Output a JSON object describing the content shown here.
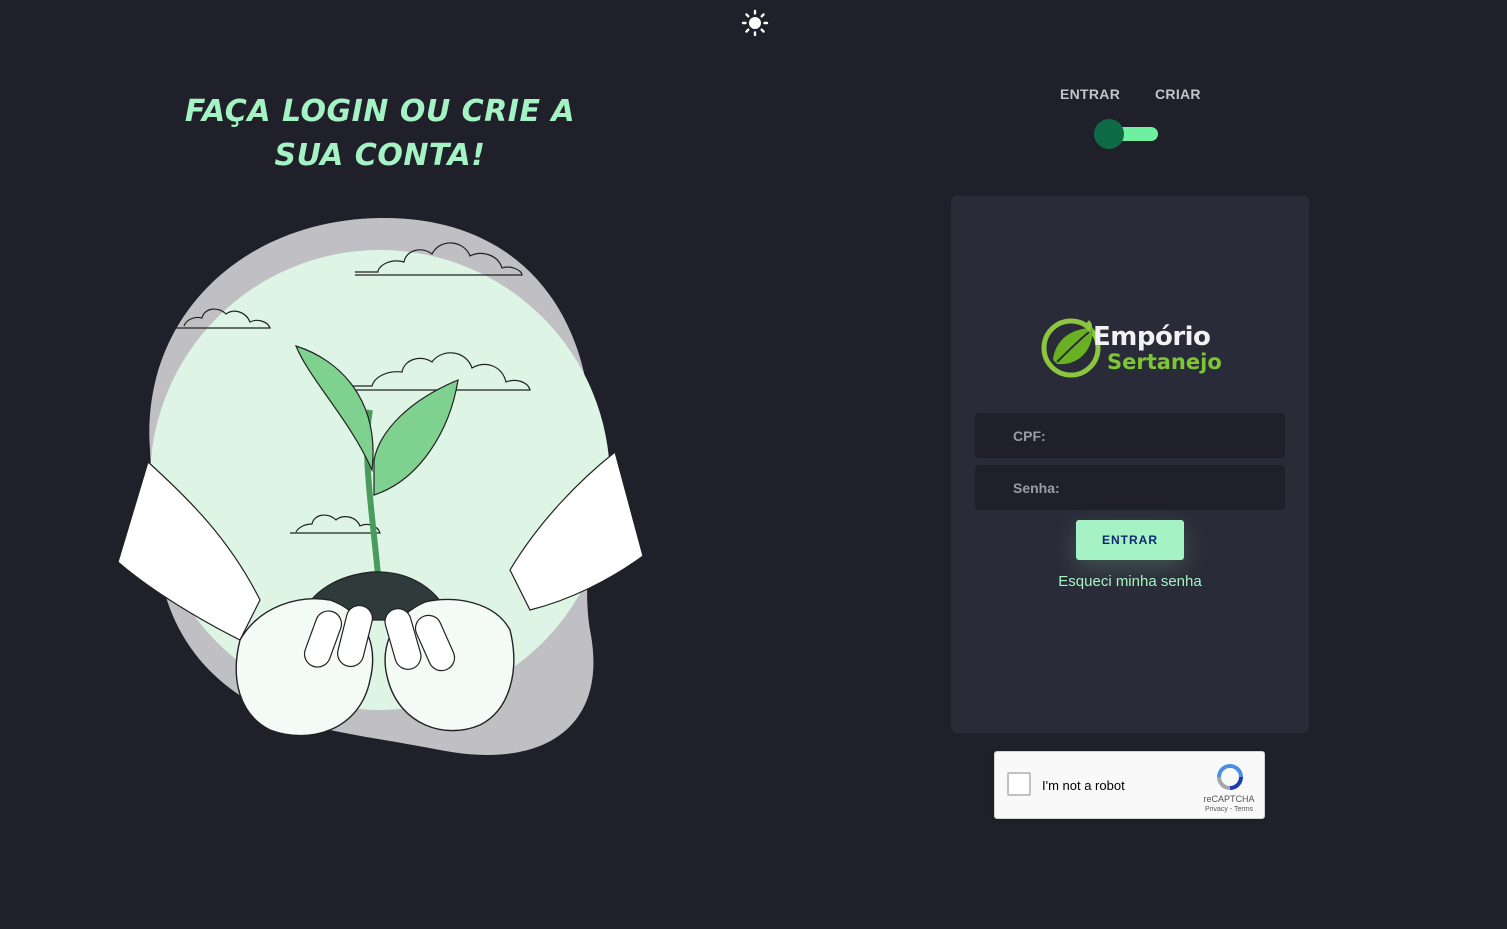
{
  "headline": {
    "line1": "FAÇA LOGIN OU CRIE A",
    "line2": "SUA CONTA!"
  },
  "icons": {
    "theme": "sun-icon",
    "illustration": "plant-in-hands-illustration",
    "logo": "leaf-logo-icon"
  },
  "tabs": {
    "entrar": "ENTRAR",
    "criar": "CRIAR",
    "active": "entrar"
  },
  "brand": {
    "name_top": "Empório",
    "name_bottom": "Sertanejo"
  },
  "form": {
    "cpf_placeholder": "CPF:",
    "senha_placeholder": "Senha:",
    "submit_label": "ENTRAR",
    "forgot_label": "Esqueci minha senha"
  },
  "recaptcha": {
    "label": "I'm not a robot",
    "brand": "reCAPTCHA",
    "links": "Privacy - Terms"
  },
  "colors": {
    "background": "#1f2029",
    "card": "#2a2b38",
    "accent": "#a5f3c4",
    "switch_knob": "#0f6b45",
    "logo_green": "#7dc734"
  }
}
